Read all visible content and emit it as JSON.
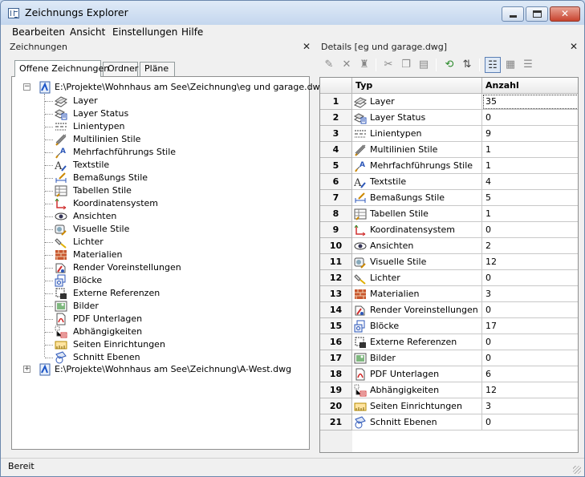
{
  "window": {
    "title": "Zeichnungs Explorer"
  },
  "menu": [
    "Bearbeiten",
    "Ansicht",
    "Einstellungen",
    "Hilfe"
  ],
  "left_panel": {
    "title": "Zeichnungen",
    "tabs": [
      "Offene Zeichnungen",
      "Ordner",
      "Pläne"
    ],
    "tree": {
      "roots": [
        {
          "label": "E:\\Projekte\\Wohnhaus am See\\Zeichnung\\eg und garage.dwg",
          "expander": "−"
        },
        {
          "label": "E:\\Projekte\\Wohnhaus am See\\Zeichnung\\A-West.dwg",
          "expander": "+"
        }
      ],
      "items": [
        {
          "label": "Layer",
          "icon": "layer-icon"
        },
        {
          "label": "Layer Status",
          "icon": "layer-status-icon"
        },
        {
          "label": "Linientypen",
          "icon": "linetype-icon"
        },
        {
          "label": "Multilinien Stile",
          "icon": "multiline-style-icon"
        },
        {
          "label": "Mehrfachführungs Stile",
          "icon": "multileader-style-icon"
        },
        {
          "label": "Textstile",
          "icon": "text-style-icon"
        },
        {
          "label": "Bemaßungs Stile",
          "icon": "dimension-style-icon"
        },
        {
          "label": "Tabellen Stile",
          "icon": "table-style-icon"
        },
        {
          "label": "Koordinatensystem",
          "icon": "ucs-icon"
        },
        {
          "label": "Ansichten",
          "icon": "view-eye-icon"
        },
        {
          "label": "Visuelle Stile",
          "icon": "visual-style-icon"
        },
        {
          "label": "Lichter",
          "icon": "light-icon"
        },
        {
          "label": "Materialien",
          "icon": "material-brick-icon"
        },
        {
          "label": "Render Voreinstellungen",
          "icon": "render-preset-icon"
        },
        {
          "label": "Blöcke",
          "icon": "block-icon"
        },
        {
          "label": "Externe Referenzen",
          "icon": "xref-icon"
        },
        {
          "label": "Bilder",
          "icon": "image-icon"
        },
        {
          "label": "PDF Unterlagen",
          "icon": "pdf-underlay-icon"
        },
        {
          "label": "Abhängigkeiten",
          "icon": "constraint-icon"
        },
        {
          "label": "Seiten Einrichtungen",
          "icon": "page-setup-icon"
        },
        {
          "label": "Schnitt Ebenen",
          "icon": "section-plane-icon"
        }
      ]
    }
  },
  "right_panel": {
    "title": "Details [eg und garage.dwg]",
    "toolbar": [
      {
        "icon": "new-item-icon"
      },
      {
        "icon": "delete-icon"
      },
      {
        "icon": "purge-icon"
      },
      {
        "icon": "cut-icon"
      },
      {
        "icon": "copy-icon"
      },
      {
        "icon": "paste-icon"
      },
      {
        "icon": "refresh-icon"
      },
      {
        "icon": "sync-icon"
      },
      {
        "icon": "details-view-icon"
      },
      {
        "icon": "icon-view-icon"
      },
      {
        "icon": "tree-view-icon"
      }
    ],
    "grid": {
      "columns": [
        "",
        "Typ",
        "Anzahl"
      ],
      "rows": [
        {
          "n": "1",
          "typ": "Layer",
          "count": "35",
          "icon": "layer-icon"
        },
        {
          "n": "2",
          "typ": "Layer Status",
          "count": "0",
          "icon": "layer-status-icon"
        },
        {
          "n": "3",
          "typ": "Linientypen",
          "count": "9",
          "icon": "linetype-icon"
        },
        {
          "n": "4",
          "typ": "Multilinien Stile",
          "count": "1",
          "icon": "multiline-style-icon"
        },
        {
          "n": "5",
          "typ": "Mehrfachführungs Stile",
          "count": "1",
          "icon": "multileader-style-icon"
        },
        {
          "n": "6",
          "typ": "Textstile",
          "count": "4",
          "icon": "text-style-icon"
        },
        {
          "n": "7",
          "typ": "Bemaßungs Stile",
          "count": "5",
          "icon": "dimension-style-icon"
        },
        {
          "n": "8",
          "typ": "Tabellen Stile",
          "count": "1",
          "icon": "table-style-icon"
        },
        {
          "n": "9",
          "typ": "Koordinatensystem",
          "count": "0",
          "icon": "ucs-icon"
        },
        {
          "n": "10",
          "typ": "Ansichten",
          "count": "2",
          "icon": "view-eye-icon"
        },
        {
          "n": "11",
          "typ": "Visuelle Stile",
          "count": "12",
          "icon": "visual-style-icon"
        },
        {
          "n": "12",
          "typ": "Lichter",
          "count": "0",
          "icon": "light-icon"
        },
        {
          "n": "13",
          "typ": "Materialien",
          "count": "3",
          "icon": "material-brick-icon"
        },
        {
          "n": "14",
          "typ": "Render Voreinstellungen",
          "count": "0",
          "icon": "render-preset-icon"
        },
        {
          "n": "15",
          "typ": "Blöcke",
          "count": "17",
          "icon": "block-icon"
        },
        {
          "n": "16",
          "typ": "Externe Referenzen",
          "count": "0",
          "icon": "xref-icon"
        },
        {
          "n": "17",
          "typ": "Bilder",
          "count": "0",
          "icon": "image-icon"
        },
        {
          "n": "18",
          "typ": "PDF Unterlagen",
          "count": "6",
          "icon": "pdf-underlay-icon"
        },
        {
          "n": "19",
          "typ": "Abhängigkeiten",
          "count": "12",
          "icon": "constraint-icon"
        },
        {
          "n": "20",
          "typ": "Seiten Einrichtungen",
          "count": "3",
          "icon": "page-setup-icon"
        },
        {
          "n": "21",
          "typ": "Schnitt Ebenen",
          "count": "0",
          "icon": "section-plane-icon"
        }
      ]
    }
  },
  "status": {
    "text": "Bereit"
  }
}
